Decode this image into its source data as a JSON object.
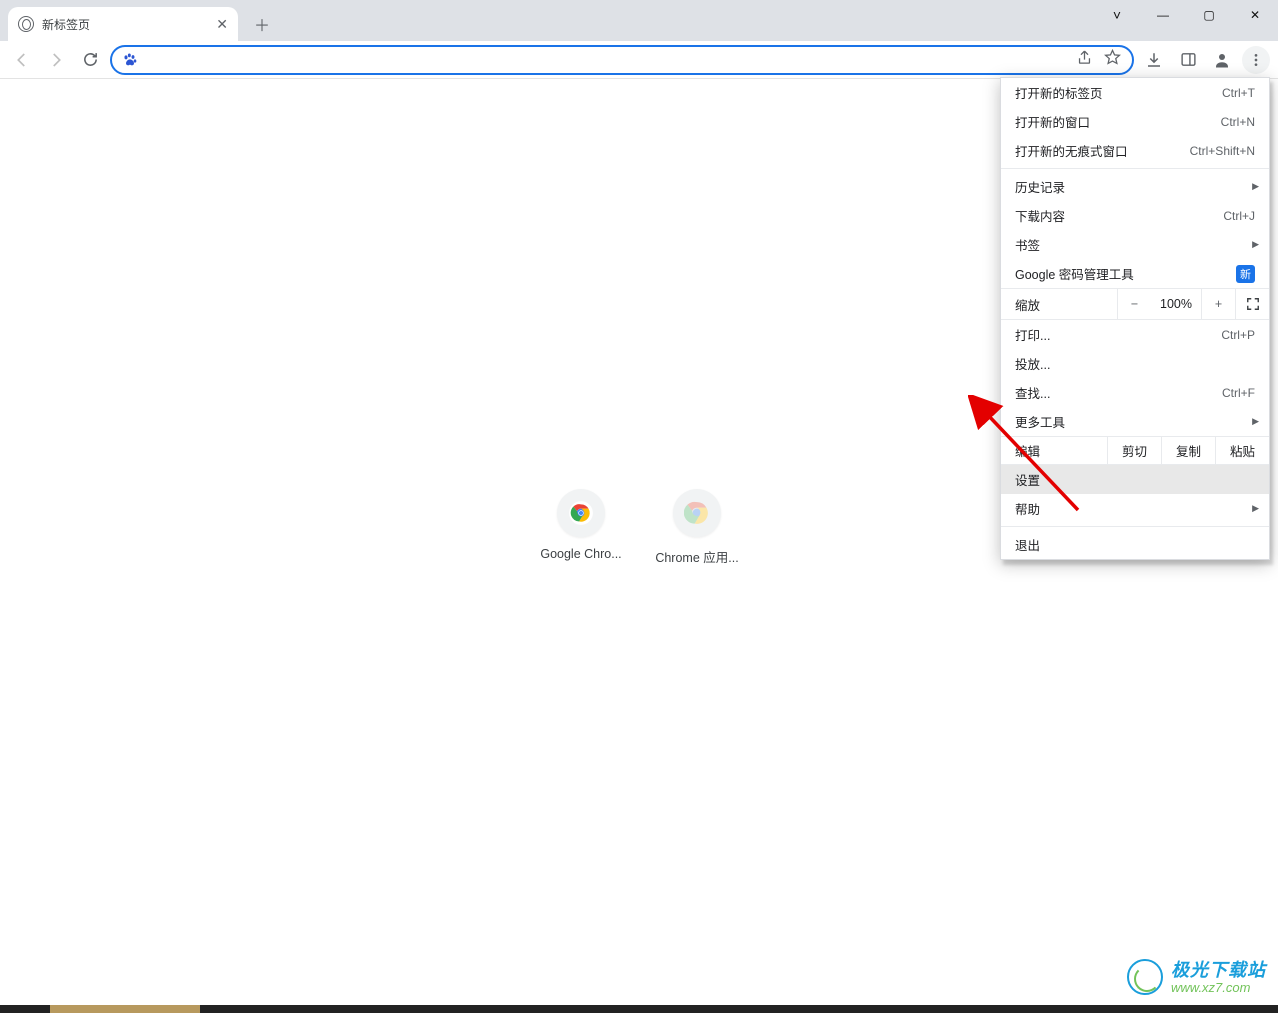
{
  "tab": {
    "title": "新标签页"
  },
  "window_controls": {
    "chevron": "˅",
    "minimize": "—",
    "maximize": "▢",
    "close": "✕"
  },
  "toolbar": {
    "address_value": "",
    "downloads_tip": "下载",
    "bookmarks_tip": "书签",
    "profile_tip": "用户",
    "menu_tip": "更多"
  },
  "shortcuts": [
    {
      "label": "Google Chro..."
    },
    {
      "label": "Chrome 应用..."
    }
  ],
  "menu": {
    "new_tab": {
      "label": "打开新的标签页",
      "shortcut": "Ctrl+T"
    },
    "new_window": {
      "label": "打开新的窗口",
      "shortcut": "Ctrl+N"
    },
    "incognito": {
      "label": "打开新的无痕式窗口",
      "shortcut": "Ctrl+Shift+N"
    },
    "history": {
      "label": "历史记录"
    },
    "downloads": {
      "label": "下载内容",
      "shortcut": "Ctrl+J"
    },
    "bookmarks": {
      "label": "书签"
    },
    "passwords": {
      "label": "Google 密码管理工具",
      "badge": "新"
    },
    "zoom": {
      "label": "缩放",
      "value": "100%",
      "minus": "−",
      "plus": "+"
    },
    "print": {
      "label": "打印...",
      "shortcut": "Ctrl+P"
    },
    "cast": {
      "label": "投放..."
    },
    "find": {
      "label": "查找...",
      "shortcut": "Ctrl+F"
    },
    "more_tools": {
      "label": "更多工具"
    },
    "edit": {
      "label": "编辑",
      "cut": "剪切",
      "copy": "复制",
      "paste": "粘贴"
    },
    "settings": {
      "label": "设置"
    },
    "help": {
      "label": "帮助"
    },
    "exit": {
      "label": "退出"
    }
  },
  "watermark": {
    "line1": "极光下载站",
    "line2": "www.xz7.com"
  }
}
